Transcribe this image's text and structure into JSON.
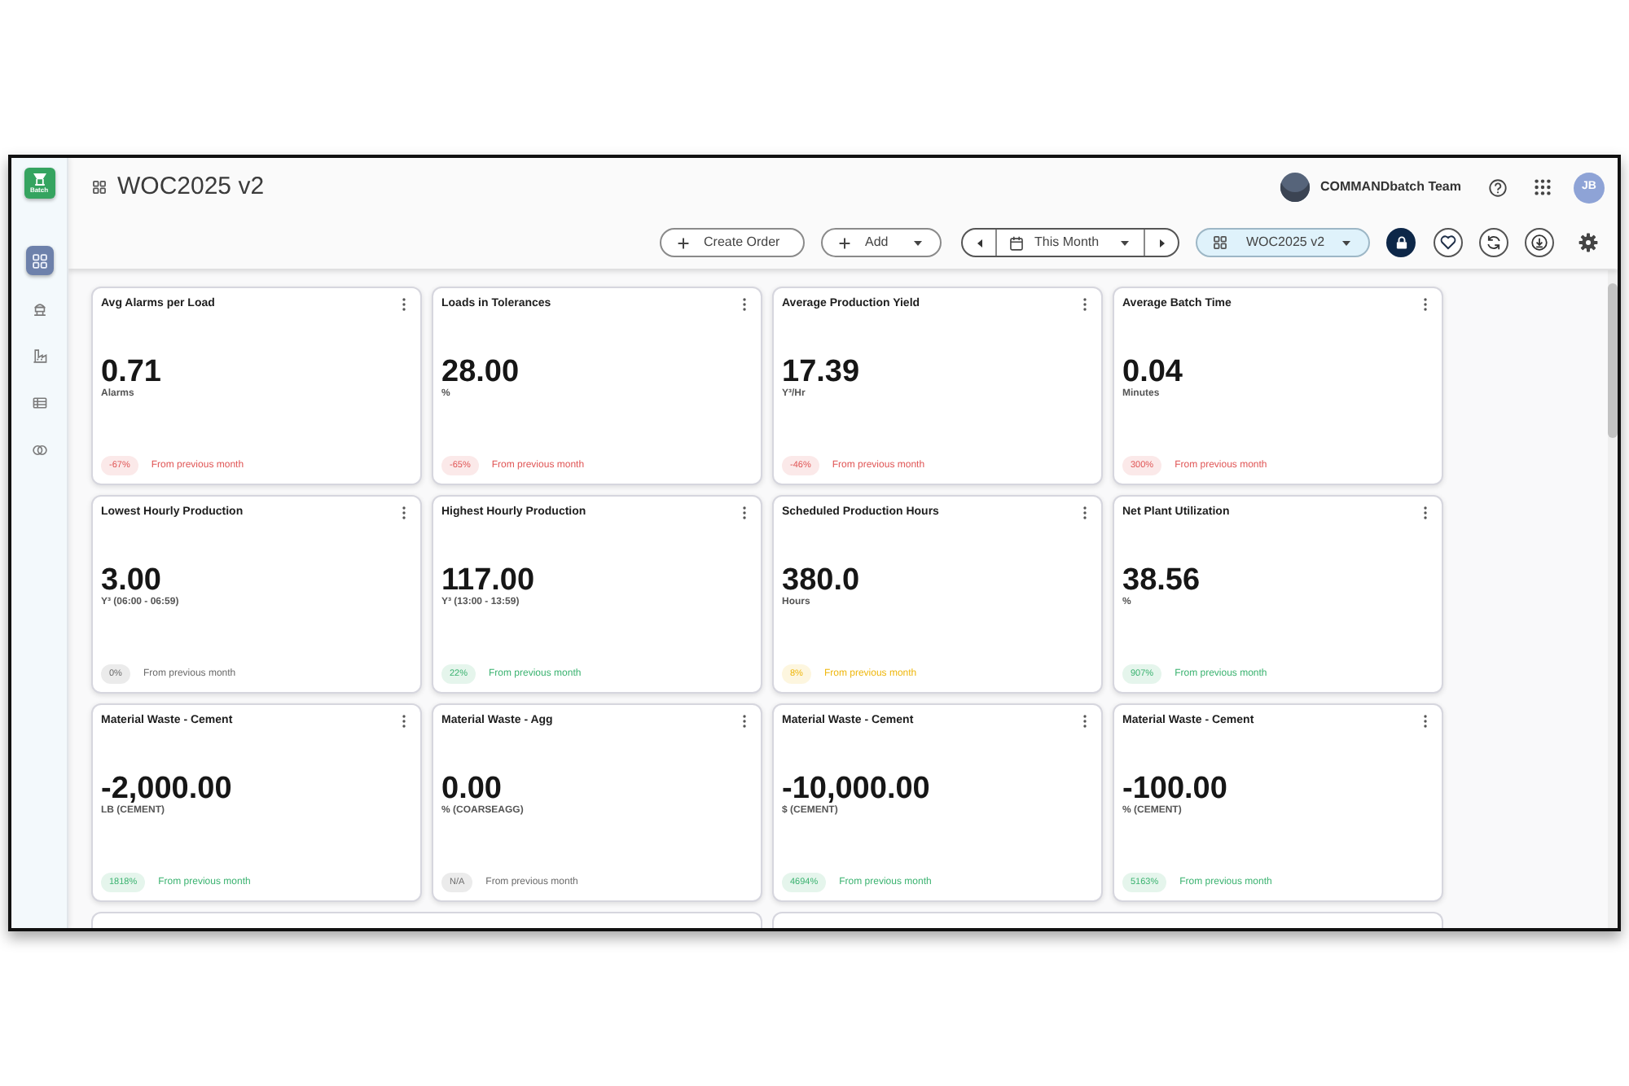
{
  "app": {
    "logo_text": "Batch"
  },
  "sidebar": {
    "items": [
      {
        "kind": "dashboard",
        "selected": true
      },
      {
        "kind": "hopper",
        "selected": false
      },
      {
        "kind": "factory",
        "selected": false
      },
      {
        "kind": "table",
        "selected": false
      },
      {
        "kind": "circles",
        "selected": false
      }
    ]
  },
  "header": {
    "title": "WOC2025 v2",
    "team_name": "COMMANDbatch Team",
    "user_initials": "JB"
  },
  "toolbar": {
    "create_order": "Create Order",
    "add": "Add",
    "period": "This Month",
    "dashboard_select": "WOC2025 v2",
    "locked": true
  },
  "cards": [
    {
      "title": "Avg Alarms per Load",
      "value": "0.71",
      "unit": "Alarms",
      "change": "-67%",
      "note": "From previous month",
      "color": "#e05757"
    },
    {
      "title": "Loads in Tolerances",
      "value": "28.00",
      "unit": "%",
      "change": "-65%",
      "note": "From previous month",
      "color": "#e05757"
    },
    {
      "title": "Average Production Yield",
      "value": "17.39",
      "unit": "Y³/Hr",
      "change": "-46%",
      "note": "From previous month",
      "color": "#e05757"
    },
    {
      "title": "Average Batch Time",
      "value": "0.04",
      "unit": "Minutes",
      "change": "300%",
      "note": "From previous month",
      "color": "#e05757"
    },
    {
      "title": "Lowest Hourly Production",
      "value": "3.00",
      "unit": "Y³ (06:00 - 06:59)",
      "change": "0%",
      "note": "From previous month",
      "color": "#6b6b6b"
    },
    {
      "title": "Highest Hourly Production",
      "value": "117.00",
      "unit": "Y³ (13:00 - 13:59)",
      "change": "22%",
      "note": "From previous month",
      "color": "#3cb371"
    },
    {
      "title": "Scheduled Production Hours",
      "value": "380.0",
      "unit": "Hours",
      "change": "8%",
      "note": "From previous month",
      "color": "#efb810"
    },
    {
      "title": "Net Plant Utilization",
      "value": "38.56",
      "unit": "%",
      "change": "907%",
      "note": "From previous month",
      "color": "#3cb371"
    },
    {
      "title": "Material Waste - Cement",
      "value": "-2,000.00",
      "unit": "LB (CEMENT)",
      "change": "1818%",
      "note": "From previous month",
      "color": "#3cb371"
    },
    {
      "title": "Material Waste - Agg",
      "value": "0.00",
      "unit": "% (COARSEAGG)",
      "change": "N/A",
      "note": "From previous month",
      "color": "#6b6b6b"
    },
    {
      "title": "Material Waste - Cement",
      "value": "-10,000.00",
      "unit": "$ (CEMENT)",
      "change": "4694%",
      "note": "From previous month",
      "color": "#3cb371"
    },
    {
      "title": "Material Waste - Cement",
      "value": "-100.00",
      "unit": "% (CEMENT)",
      "change": "5163%",
      "note": "From previous month",
      "color": "#3cb371"
    }
  ]
}
